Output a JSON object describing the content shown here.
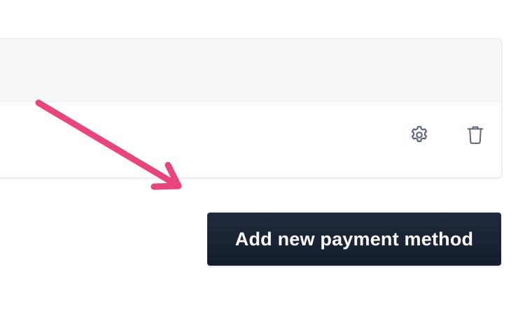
{
  "colors": {
    "button_background": "#1a2435",
    "button_text": "#ffffff",
    "annotation_arrow": "#e8457a",
    "icon_color": "#5b6575",
    "card_header_background": "#f6f7f9"
  },
  "payment_methods": {
    "row_actions": {
      "settings_icon": "gear-icon",
      "delete_icon": "trash-icon"
    }
  },
  "actions": {
    "add_payment_method_label": "Add new payment method"
  },
  "annotation": {
    "icon": "arrow-icon"
  }
}
